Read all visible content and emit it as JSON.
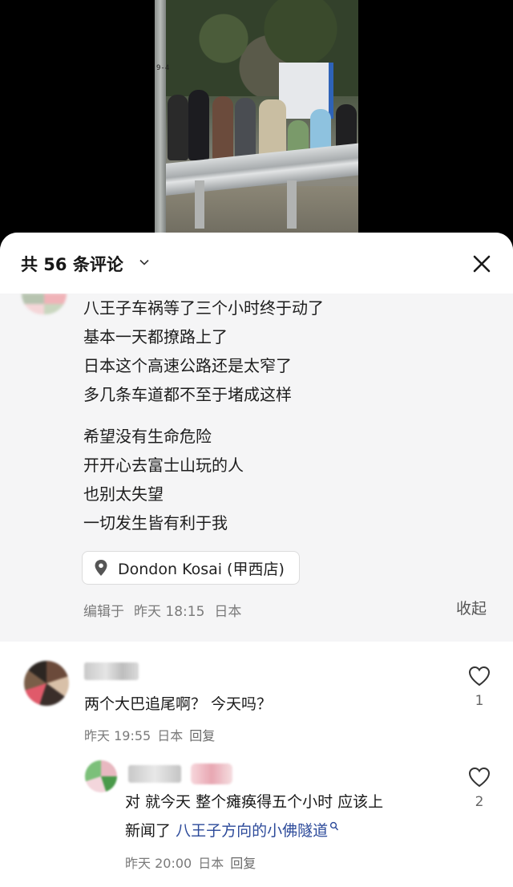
{
  "video": {
    "pole_tag": "9-4"
  },
  "header": {
    "count_title": "共 56 条评论"
  },
  "post": {
    "lines": [
      "八王子车祸等了三个小时终于动了",
      "基本一天都撩路上了",
      "日本这个高速公路还是太窄了",
      "多几条车道都不至于堵成这样",
      "希望没有生命危险",
      "开开心去富士山玩的人",
      "也别太失望",
      "一切发生皆有利于我"
    ],
    "location": "Dondon Kosai (甲西店)",
    "edited_label": "编辑于",
    "edited_time": "昨天 18:15",
    "edited_region": "日本",
    "collapse_label": "收起"
  },
  "comments": [
    {
      "text": "两个大巴追尾啊？ 今天吗？",
      "time": "昨天 19:55",
      "region": "日本",
      "reply": "回复",
      "likes": "1"
    },
    {
      "text_line1": "对 就今天 整个瘫痪得五个小时 应该上",
      "text_line2_prefix": "新闻了",
      "link": "八王子方向的小佛隧道",
      "time": "昨天 20:00",
      "region": "日本",
      "reply": "回复",
      "likes": "2"
    }
  ],
  "colors": {
    "link": "#2c4a9a",
    "post_bg": "#f5f5f6"
  },
  "icons": [
    "chevron-down-icon",
    "close-icon",
    "location-pin-icon",
    "heart-icon",
    "search-icon"
  ]
}
